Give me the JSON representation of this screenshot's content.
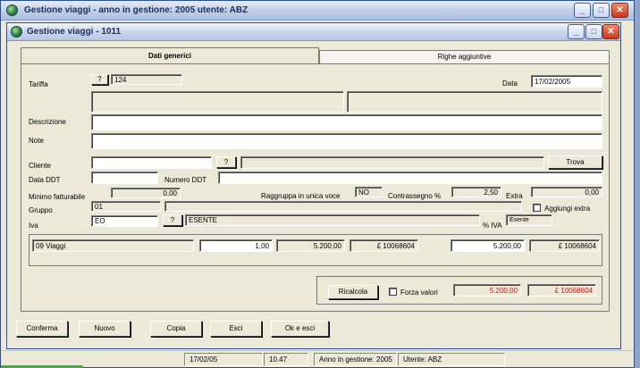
{
  "app": {
    "title": "Gestione viaggi - anno in gestione: 2005 utente: ABZ"
  },
  "window": {
    "title": "Gestione viaggi - 1011"
  },
  "window_buttons": {
    "minimize": "_",
    "maximize": "□",
    "close": "✕"
  },
  "tabs": [
    {
      "label": "Dati generici"
    },
    {
      "label": "Righe aggiuntive"
    }
  ],
  "form": {
    "tariffa": {
      "label": "Tariffa",
      "lookup": "?",
      "value": "124"
    },
    "data": {
      "label": "Data",
      "value": "17/02/2005"
    },
    "descrizione": {
      "label": "Descrizione",
      "value": ""
    },
    "note": {
      "label": "Note",
      "value": ""
    },
    "cliente": {
      "label": "Cliente",
      "value": "",
      "lookup": "?",
      "name": "",
      "trova": "Trova"
    },
    "data_ddt": {
      "label": "Data DDT",
      "value": ""
    },
    "numero_ddt": {
      "label": "Numero DDT",
      "value": ""
    },
    "minimo": {
      "label": "Minimo fatturabile",
      "value": "0,00"
    },
    "raggruppa": {
      "label": "Raggruppa in unica voce",
      "value": "NO"
    },
    "contrassegno": {
      "label": "Contrassegno %",
      "value": "2,50"
    },
    "extra": {
      "label": "Extra",
      "value": "0,00"
    },
    "gruppo": {
      "label": "Gruppo",
      "value": "01",
      "desc": ""
    },
    "aggiungi_extra": {
      "label": "Aggiungi extra",
      "checked": false
    },
    "iva": {
      "label": "Iva",
      "value": "EO",
      "lookup": "?",
      "desc": "ESENTE"
    },
    "perc_iva": {
      "label": "% IVA",
      "value": "Esente"
    }
  },
  "row": {
    "desc": "09 Viaggi",
    "qty": "1,00",
    "price": "5.200,00",
    "price_lit": "£ 10068604",
    "total": "5.200,00",
    "total_lit": "£ 10068604"
  },
  "totals": {
    "ricalcola": "Ricalcola",
    "forza_label": "Forza valori",
    "total": "5.200,00",
    "total_lit": "£ 10068604"
  },
  "actions": {
    "conferma": "Conferma",
    "nuovo": "Nuovo",
    "copia": "Copia",
    "esci": "Esci",
    "ok_esci": "Ok e esci"
  },
  "statusbar": {
    "date": "17/02/05",
    "time": "10.47",
    "anno": "Anno in gestione: 2005",
    "utente": "Utente: ABZ"
  },
  "colors": {
    "accent_red": "#d01414",
    "title_blue": "#1c2f5e",
    "face": "#ece9d8"
  }
}
